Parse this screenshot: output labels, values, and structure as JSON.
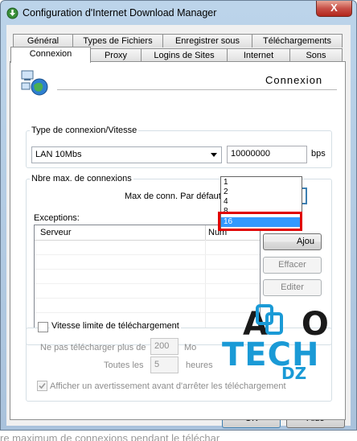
{
  "window": {
    "title": "Configuration d'Internet Download Manager",
    "close_label": "X"
  },
  "tabs_row1": [
    "Général",
    "Types de Fichiers",
    "Enregistrer sous",
    "Téléchargements"
  ],
  "tabs_row2": [
    "Connexion",
    "Proxy",
    "Logins de Sites",
    "Internet",
    "Sons"
  ],
  "active_tab": "Connexion",
  "header": {
    "title": "Connexion"
  },
  "connection_type": {
    "label": "Type de connexion/Vitesse",
    "selected": "LAN 10Mbs",
    "speed_value": "10000000",
    "unit": "bps"
  },
  "max_connections": {
    "label": "Nbre max. de connexions",
    "default_label": "Max de conn. Par défaut",
    "selected": "16",
    "options": [
      "1",
      "2",
      "4",
      "8",
      "16"
    ]
  },
  "exceptions": {
    "label": "Exceptions:",
    "columns": [
      "Serveur",
      "Num"
    ],
    "buttons": {
      "add": "Ajou",
      "delete": "Effacer",
      "edit": "Editer"
    }
  },
  "speed_limit": {
    "checkbox_label": "Vitesse limite de téléchargement",
    "max_label": "Ne pas télécharger plus de",
    "max_value": "200",
    "max_unit": "Mo",
    "every_label": "Toutes les",
    "every_value": "5",
    "every_unit": "heures",
    "warn_label": "Afficher un avertissement avant d'arrêter les téléchargement"
  },
  "footer": {
    "ok": "OK",
    "help": "Aide"
  },
  "watermark": {
    "line1": "A O",
    "line2": "TECH",
    "line3": "DZ",
    "letter_t": "T"
  },
  "bottom_caption": "re maximum de connexions pendant le téléchar",
  "colors": {
    "highlight": "#e00000",
    "selection": "#3399ff",
    "watermark_dark": "#1a1a1a",
    "watermark_blue": "#1a9ad6"
  }
}
